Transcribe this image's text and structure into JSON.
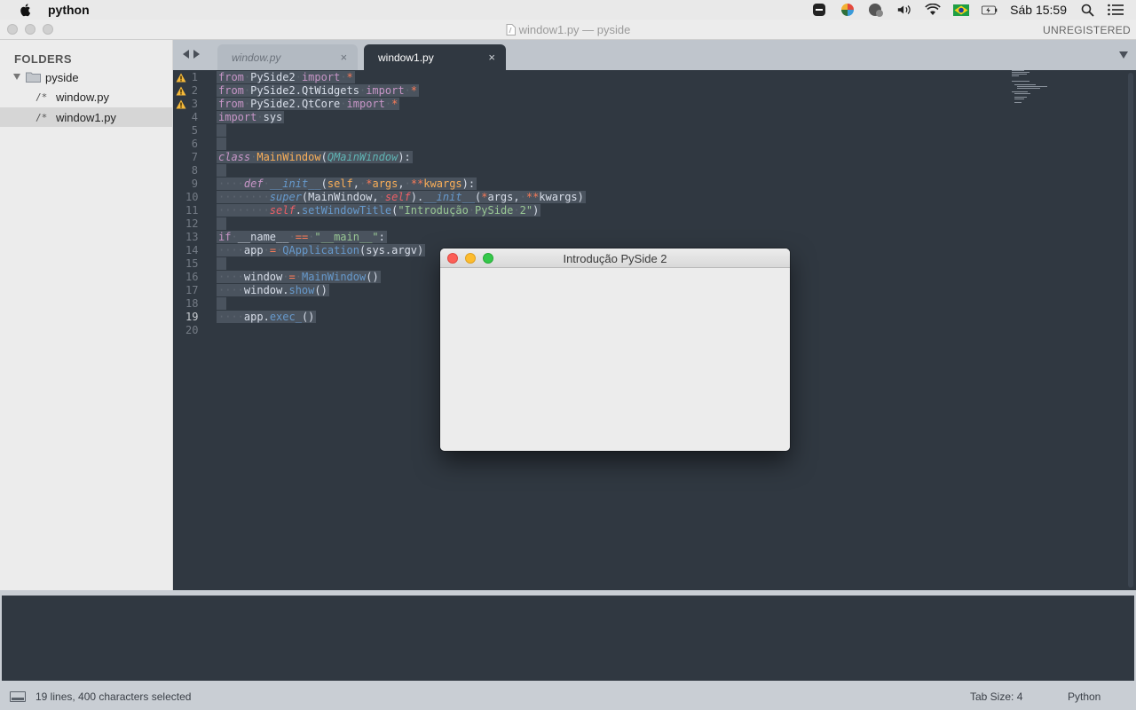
{
  "menubar": {
    "app_name": "python",
    "clock": "Sáb 15:59"
  },
  "window": {
    "title": "window1.py — pyside",
    "license": "UNREGISTERED"
  },
  "sidebar": {
    "heading": "FOLDERS",
    "folder": "pyside",
    "files": [
      {
        "glyph": "/*",
        "name": "window.py",
        "selected": false
      },
      {
        "glyph": "/*",
        "name": "window1.py",
        "selected": true
      }
    ]
  },
  "tabs": [
    {
      "label": "window.py",
      "active": false,
      "close": "×"
    },
    {
      "label": "window1.py",
      "active": true,
      "close": "×"
    }
  ],
  "editor": {
    "line_numbers": [
      "1",
      "2",
      "3",
      "4",
      "5",
      "6",
      "7",
      "8",
      "9",
      "10",
      "11",
      "12",
      "13",
      "14",
      "15",
      "16",
      "17",
      "18",
      "19",
      "20"
    ],
    "warning_lines": [
      1,
      2,
      3
    ],
    "current_line": 19
  },
  "qt_window": {
    "title": "Introdução PySide 2"
  },
  "statusbar": {
    "selection": "19 lines, 400 characters selected",
    "tab_size": "Tab Size: 4",
    "syntax": "Python"
  },
  "colors": {
    "editor_bg": "#303841",
    "selection_bg": "#4a535e",
    "keyword": "#c695c6",
    "function": "#6699cc",
    "string": "#99c794",
    "self": "#ec5f66",
    "class_name": "#f9ae58",
    "operator": "#f97b58"
  }
}
